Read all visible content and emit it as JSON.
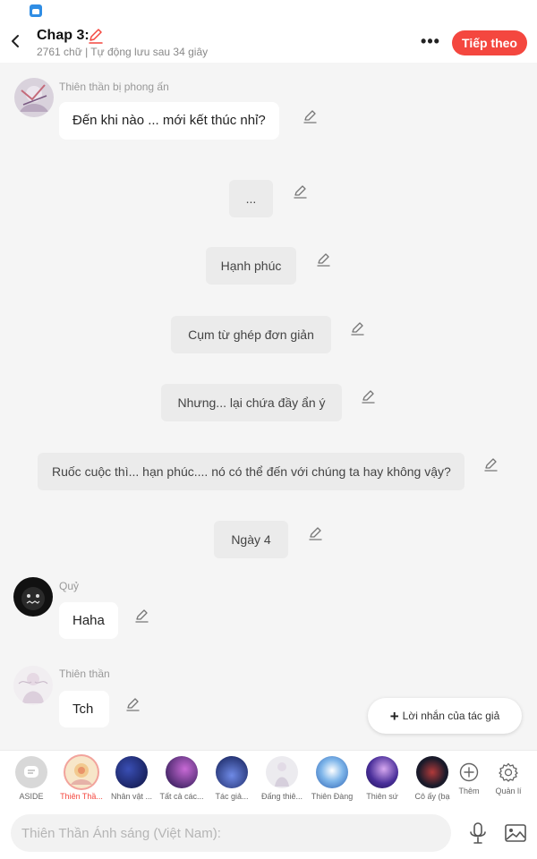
{
  "status_bar": {
    "app_icon": "app-store-icon"
  },
  "header": {
    "title": "Chap 3:",
    "subtitle": "2761 chữ | Tự động lưu sau 34 giây",
    "next_label": "Tiếp theo",
    "more_label": "•••",
    "colors": {
      "accent": "#f4473f"
    }
  },
  "messages": [
    {
      "type": "character",
      "sender": "Thiên thần bị phong ấn",
      "text": "Đến khi nào ... mới kết thúc nhỉ?",
      "avatar": "sealed-angel-avatar"
    },
    {
      "type": "narration",
      "text": "..."
    },
    {
      "type": "narration",
      "text": "Hạnh phúc"
    },
    {
      "type": "narration",
      "text": "Cụm từ ghép đơn giản"
    },
    {
      "type": "narration",
      "text": "Nhưng... lại chứa đầy ẩn ý"
    },
    {
      "type": "narration",
      "text": "Ruốc cuộc thì... hạn phúc.... nó có thể đến với chúng ta hay không vậy?"
    },
    {
      "type": "narration",
      "text": "Ngày 4"
    },
    {
      "type": "character",
      "sender": "Quỷ",
      "text": "Haha",
      "avatar": "demon-avatar"
    },
    {
      "type": "character",
      "sender": "Thiên thần",
      "text": "Tch",
      "avatar": "angel-avatar"
    }
  ],
  "author_note_label": "Lời nhắn của tác giả",
  "characters": [
    {
      "label": "ASIDE",
      "selected": false
    },
    {
      "label": "Thiên Thầ...",
      "selected": true
    },
    {
      "label": "Nhân vật ...",
      "selected": false
    },
    {
      "label": "Tất cả các...",
      "selected": false
    },
    {
      "label": "Tác giả...",
      "selected": false
    },
    {
      "label": "Đấng thiê...",
      "selected": false
    },
    {
      "label": "Thiên Đàng",
      "selected": false
    },
    {
      "label": "Thiên sứ",
      "selected": false
    },
    {
      "label": "Cô ấy (bạ",
      "selected": false
    },
    {
      "label": "Thêm",
      "selected": false
    },
    {
      "label": "Quản lí",
      "selected": false
    }
  ],
  "input": {
    "placeholder": "Thiên Thần Ánh sáng (Việt Nam):",
    "value": ""
  }
}
